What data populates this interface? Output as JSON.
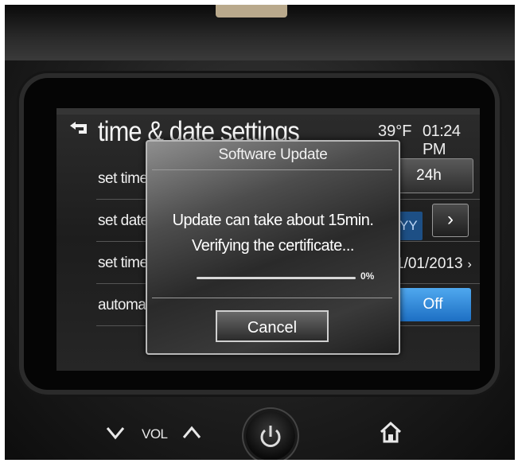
{
  "screen": {
    "title": "time & date settings",
    "back_icon": "back-arrow-icon",
    "temperature": "39°F",
    "clock": "01:24 PM",
    "rows": [
      {
        "label": "set time"
      },
      {
        "label": "set date"
      },
      {
        "label": "set time"
      },
      {
        "label": "automat"
      }
    ],
    "time_format_button": "24h",
    "date_format_value": "YY",
    "date_value": "1/01/2013",
    "date_chevron": "›",
    "format_chevron": "›",
    "automatic_toggle": "Off"
  },
  "dialog": {
    "title": "Software Update",
    "message_line1": "Update can take about 15min.",
    "message_line2": "Verifying the certificate...",
    "progress_percent": 0,
    "progress_label": "0%",
    "cancel_label": "Cancel"
  },
  "hardware": {
    "vol_down_icon": "chevron-down-icon",
    "vol_label": "VOL",
    "vol_up_icon": "chevron-up-icon",
    "power_icon": "power-icon",
    "home_icon": "home-icon"
  },
  "colors": {
    "toggle_accent": "#1d6fc3",
    "progress_accent": "#3aa0ff"
  }
}
